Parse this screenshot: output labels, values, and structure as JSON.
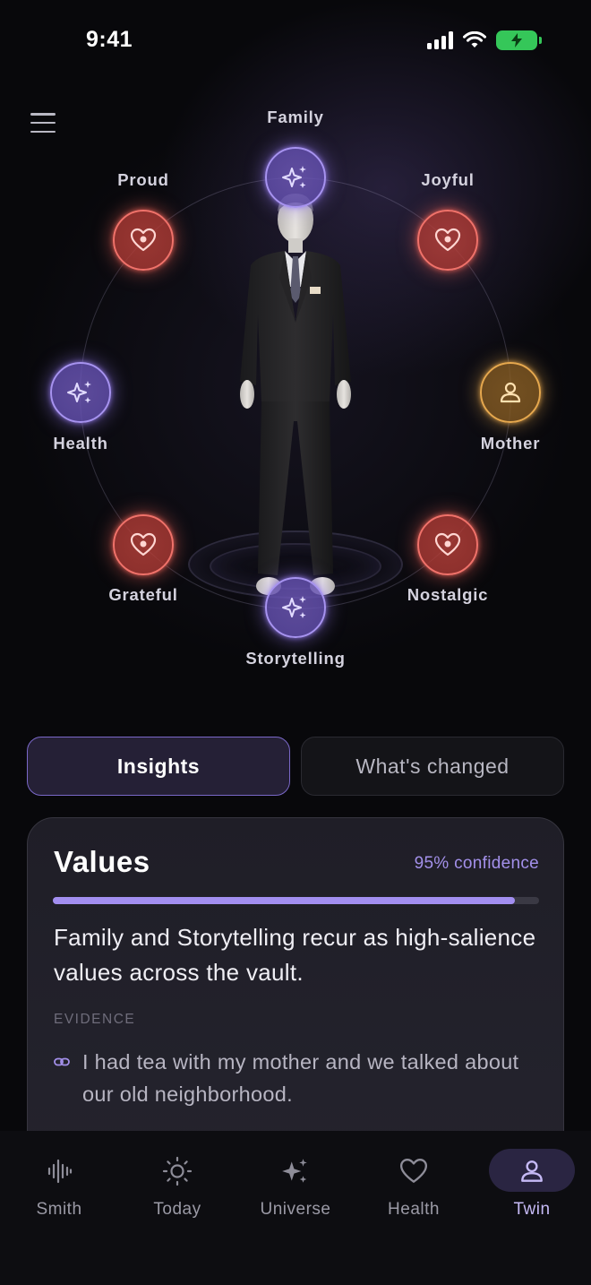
{
  "status_bar": {
    "time": "9:41"
  },
  "orbit": {
    "nodes": [
      {
        "id": "family",
        "label": "Family",
        "kind": "purple",
        "icon": "sparkles-icon"
      },
      {
        "id": "joyful",
        "label": "Joyful",
        "kind": "red",
        "icon": "heart-icon"
      },
      {
        "id": "proud",
        "label": "Proud",
        "kind": "red",
        "icon": "heart-icon"
      },
      {
        "id": "health",
        "label": "Health",
        "kind": "purple",
        "icon": "sparkles-icon"
      },
      {
        "id": "mother",
        "label": "Mother",
        "kind": "amber",
        "icon": "person-icon"
      },
      {
        "id": "grateful",
        "label": "Grateful",
        "kind": "red",
        "icon": "heart-icon"
      },
      {
        "id": "nostalgic",
        "label": "Nostalgic",
        "kind": "red",
        "icon": "heart-icon"
      },
      {
        "id": "storytelling",
        "label": "Storytelling",
        "kind": "purple",
        "icon": "sparkles-icon"
      }
    ]
  },
  "tabs": {
    "insights": "Insights",
    "whats_changed": "What's changed"
  },
  "card": {
    "title": "Values",
    "confidence_text": "95% confidence",
    "confidence_value": 0.95,
    "body": "Family and Storytelling recur as high-salience values across the vault.",
    "evidence_label": "EVIDENCE",
    "evidence": [
      {
        "icon": "link-icon",
        "text": "I had tea with my mother and we talked about our old neighborhood."
      }
    ]
  },
  "bottom_nav": {
    "items": [
      {
        "id": "smith",
        "label": "Smith",
        "icon": "waveform-icon"
      },
      {
        "id": "today",
        "label": "Today",
        "icon": "sun-icon"
      },
      {
        "id": "universe",
        "label": "Universe",
        "icon": "sparkles-icon"
      },
      {
        "id": "health",
        "label": "Health",
        "icon": "heart-icon"
      },
      {
        "id": "twin",
        "label": "Twin",
        "icon": "person-icon",
        "active": true
      }
    ]
  },
  "colors": {
    "accent": "#a28ef0",
    "emotion_red": "#f0726a",
    "value_purple": "#a793f0",
    "person_amber": "#e6a84e",
    "battery_green": "#35c759"
  }
}
